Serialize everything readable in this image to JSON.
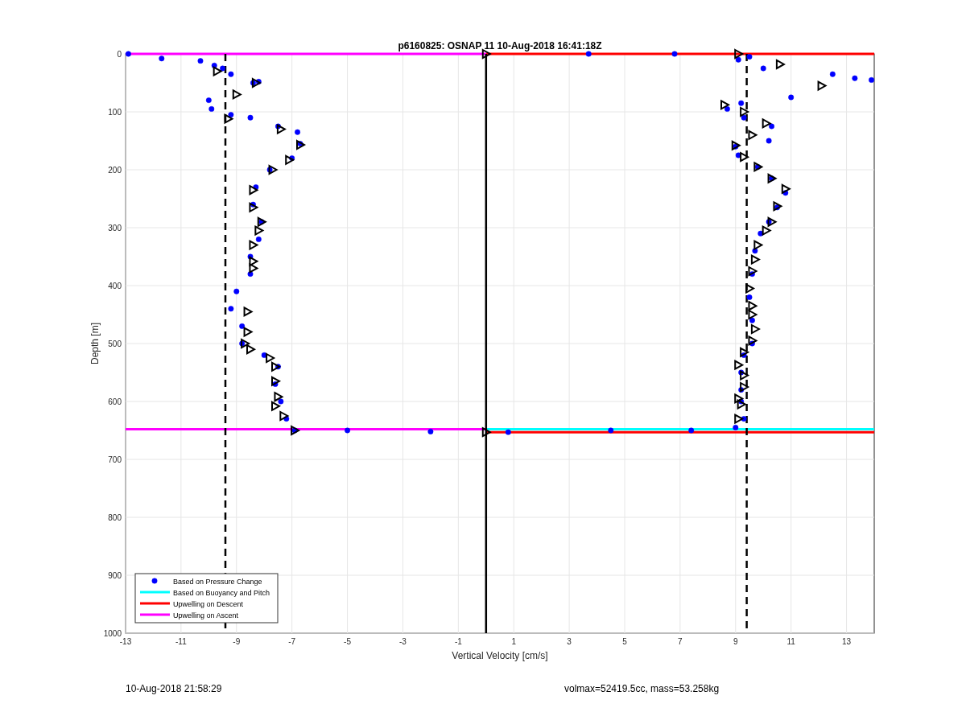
{
  "chart_data": {
    "type": "scatter",
    "title": "p6160825: OSNAP 11 10-Aug-2018 16:41:18Z",
    "xlabel": "Vertical Velocity [cm/s]",
    "ylabel": "Depth [m]",
    "xlim": [
      -13,
      14
    ],
    "ylim": [
      1000,
      0
    ],
    "xticks": [
      -13,
      -11,
      -9,
      -7,
      -5,
      -3,
      -1,
      1,
      3,
      5,
      7,
      9,
      11,
      13
    ],
    "yticks": [
      0,
      100,
      200,
      300,
      400,
      500,
      600,
      700,
      800,
      900,
      1000
    ],
    "grid": true,
    "legend": true,
    "series": [
      {
        "name": "Based on Pressure Change",
        "type": "scatter",
        "marker": "circle",
        "color": "#0000ff",
        "x": [
          -12.9,
          -11.7,
          -10.3,
          -9.8,
          -9.5,
          -9.2,
          -8.4,
          -8.2,
          -10,
          -9.9,
          -9.2,
          -8.5,
          -7.5,
          -6.8,
          -6.7,
          -7.0,
          -7.8,
          -8.3,
          -8.4,
          -8.1,
          -8.2,
          -8.5,
          -8.5,
          -9,
          -9.2,
          -8.8,
          -8.8,
          -8,
          -7.5,
          -7.6,
          -7.4,
          -7.2,
          -6.9,
          -5,
          -2,
          0.8,
          3.7,
          6.8,
          9.1,
          9.5,
          10,
          12.5,
          13.9,
          13.3,
          11,
          9.2,
          8.7,
          9.3,
          10.3,
          10.2,
          9.0,
          9.1,
          9.8,
          10.3,
          10.8,
          10.5,
          10.2,
          9.9,
          9.7,
          9.6,
          9.5,
          9.6,
          9.6,
          9.3,
          9.2,
          9.2,
          9.2,
          9.3,
          9.0,
          7.4,
          4.5
        ],
        "values": [
          0,
          8,
          12,
          20,
          25,
          35,
          50,
          48,
          80,
          95,
          105,
          110,
          125,
          135,
          155,
          180,
          200,
          230,
          260,
          290,
          320,
          350,
          380,
          410,
          440,
          470,
          500,
          520,
          540,
          570,
          600,
          630,
          650,
          650,
          652,
          653,
          0,
          0,
          10,
          5,
          25,
          35,
          45,
          42,
          75,
          85,
          95,
          110,
          125,
          150,
          160,
          175,
          195,
          215,
          240,
          265,
          290,
          310,
          340,
          380,
          420,
          460,
          500,
          520,
          550,
          580,
          600,
          630,
          645,
          650,
          650
        ]
      },
      {
        "name": "Based on Buoyancy and Pitch",
        "type": "line",
        "color": "#00ffff",
        "x": [
          0,
          14
        ],
        "values": [
          648,
          648
        ]
      },
      {
        "name": "Upwelling on Descent",
        "type": "line",
        "color": "#ff0000",
        "x": [
          0,
          14
        ],
        "values": [
          0,
          0
        ]
      },
      {
        "name": "Upwelling on Ascent",
        "type": "line",
        "color": "#ff00ff",
        "x": [
          -13,
          0
        ],
        "values": [
          0,
          0
        ]
      },
      {
        "type": "line",
        "color": "#ff0000",
        "x": [
          0,
          14
        ],
        "values": [
          653,
          653
        ]
      },
      {
        "type": "line",
        "color": "#ff00ff",
        "x": [
          -13,
          0
        ],
        "values": [
          648,
          648
        ]
      },
      {
        "type": "line",
        "line_style": "dashed",
        "color": "#000000",
        "x": [
          -9.4,
          -9.4
        ],
        "values": [
          0,
          1000
        ]
      },
      {
        "type": "line",
        "line_style": "dashed",
        "color": "#000000",
        "x": [
          9.4,
          9.4
        ],
        "values": [
          0,
          1000
        ]
      },
      {
        "type": "line",
        "line_style": "solid",
        "color": "#000000",
        "x": [
          0,
          0
        ],
        "values": [
          0,
          1000
        ]
      },
      {
        "type": "scatter",
        "marker": "triangle",
        "color": "#000000",
        "x": [
          -9.7,
          -8.3,
          -9,
          -9.3,
          -7.4,
          -6.7,
          -7.1,
          -7.7,
          -8.4,
          -8.4,
          -8.1,
          -8.2,
          -8.4,
          -8.4,
          -8.4,
          -8.6,
          -8.6,
          -8.7,
          -8.5,
          -7.8,
          -7.6,
          -7.6,
          -7.5,
          -7.6,
          -7.3,
          -6.9,
          0,
          0,
          9.1,
          10.6,
          12.1,
          8.6,
          9.3,
          10.1,
          9.6,
          9.0,
          9.3,
          9.8,
          10.3,
          10.8,
          10.5,
          10.3,
          10.1,
          9.8,
          9.7,
          9.6,
          9.5,
          9.6,
          9.6,
          9.7,
          9.6,
          9.3,
          9.1,
          9.3,
          9.3,
          9.1,
          9.2,
          9.1
        ],
        "values": [
          30,
          50,
          70,
          112,
          130,
          157,
          183,
          200,
          235,
          265,
          290,
          305,
          330,
          358,
          370,
          445,
          480,
          500,
          510,
          525,
          540,
          565,
          592,
          608,
          625,
          650,
          653,
          0,
          0,
          18,
          55,
          88,
          100,
          120,
          140,
          158,
          178,
          195,
          215,
          233,
          263,
          290,
          305,
          330,
          355,
          375,
          405,
          435,
          450,
          475,
          495,
          515,
          537,
          555,
          575,
          595,
          605,
          630
        ]
      }
    ]
  },
  "footer": {
    "timestamp": "10-Aug-2018 21:58:29",
    "summary": "volmax=52419.5cc, mass=53.258kg"
  }
}
